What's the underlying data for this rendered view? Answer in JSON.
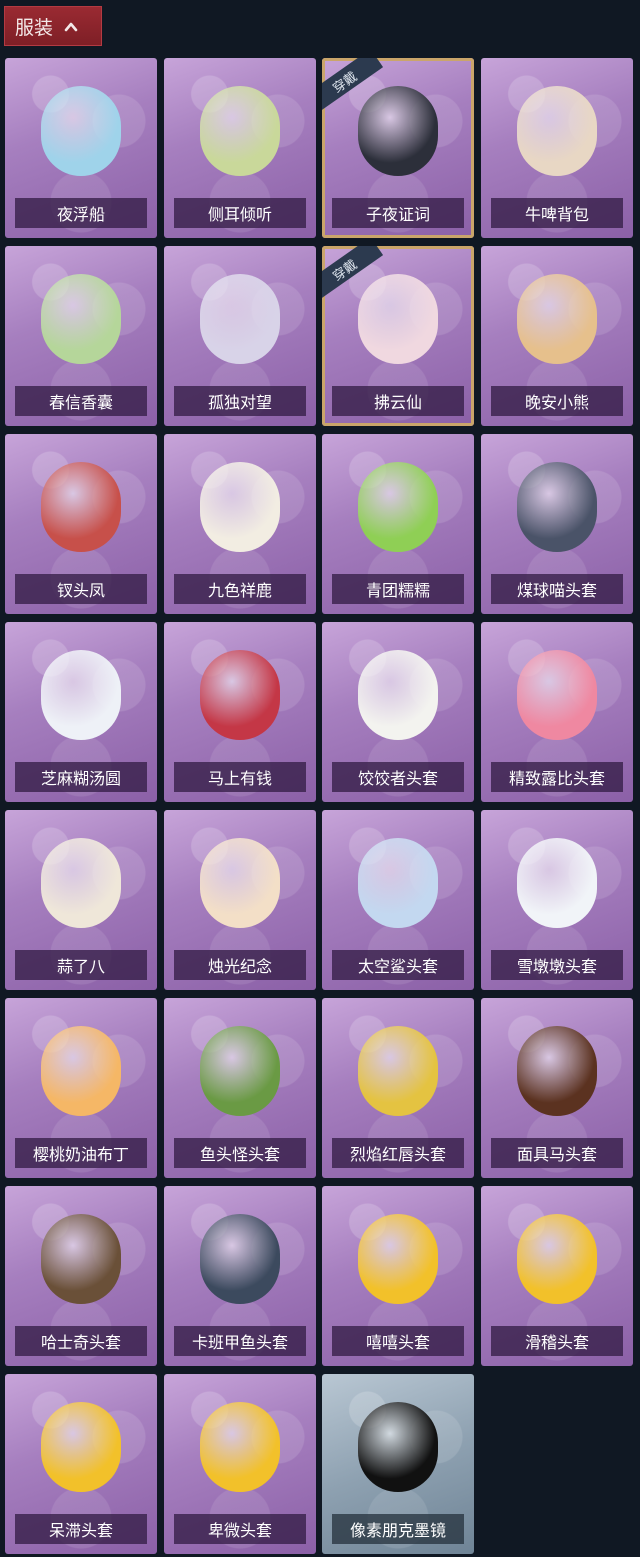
{
  "header": {
    "label": "服装",
    "icon": "chevron-up-icon"
  },
  "items": [
    {
      "label": "夜浮船",
      "color": "#9fd3ea"
    },
    {
      "label": "侧耳倾听",
      "color": "#c9d89a"
    },
    {
      "label": "子夜证词",
      "color": "#2c2f3a",
      "equipped": true,
      "badge": "穿戴"
    },
    {
      "label": "牛啤背包",
      "color": "#e8d7c4"
    },
    {
      "label": "春信香囊",
      "color": "#b5d69a"
    },
    {
      "label": "孤独对望",
      "color": "#d8d3e8"
    },
    {
      "label": "拂云仙",
      "color": "#f0d8e0",
      "equipped": true,
      "badge": "穿戴"
    },
    {
      "label": "晚安小熊",
      "color": "#e6c08c"
    },
    {
      "label": "钗头凤",
      "color": "#c7504a"
    },
    {
      "label": "九色祥鹿",
      "color": "#f2ede2"
    },
    {
      "label": "青团糯糯",
      "color": "#8fcf55"
    },
    {
      "label": "煤球喵头套",
      "color": "#4a5368"
    },
    {
      "label": "芝麻糊汤圆",
      "color": "#eef1f7"
    },
    {
      "label": "马上有钱",
      "color": "#c43746"
    },
    {
      "label": "饺饺者头套",
      "color": "#f3f3ef"
    },
    {
      "label": "精致露比头套",
      "color": "#ef88a1"
    },
    {
      "label": "蒜了八",
      "color": "#efe7d9"
    },
    {
      "label": "烛光纪念",
      "color": "#f3dfc7"
    },
    {
      "label": "太空鲨头套",
      "color": "#c3d8f0"
    },
    {
      "label": "雪墩墩头套",
      "color": "#f1f4f8"
    },
    {
      "label": "樱桃奶油布丁",
      "color": "#f5b766"
    },
    {
      "label": "鱼头怪头套",
      "color": "#6a9a44"
    },
    {
      "label": "烈焰红唇头套",
      "color": "#e4c341"
    },
    {
      "label": "面具马头套",
      "color": "#5b3220"
    },
    {
      "label": "哈士奇头套",
      "color": "#6a5038"
    },
    {
      "label": "卡班甲鱼头套",
      "color": "#3c4a5e"
    },
    {
      "label": "嘻嘻头套",
      "color": "#f2c12a"
    },
    {
      "label": "滑稽头套",
      "color": "#f2c12a"
    },
    {
      "label": "呆滞头套",
      "color": "#f2c12a"
    },
    {
      "label": "卑微头套",
      "color": "#f2c12a"
    },
    {
      "label": "像素朋克墨镜",
      "color": "#111111",
      "special": true
    }
  ]
}
